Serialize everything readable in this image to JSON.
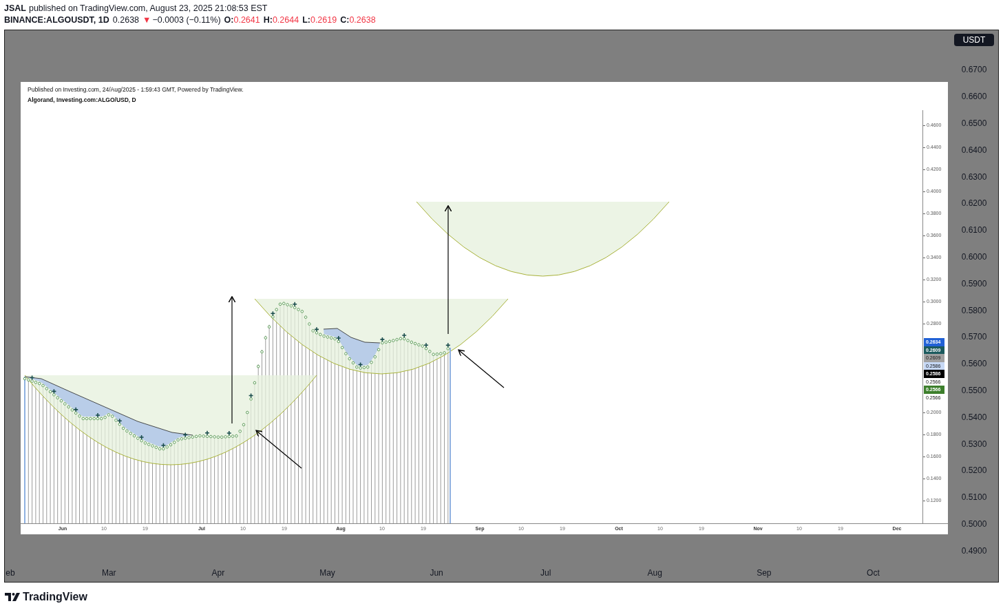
{
  "header": {
    "author": "JSAL",
    "published": "published on TradingView.com, August 23, 2025 21:08:53 EST"
  },
  "symbol_bar": {
    "symbol": "BINANCE:ALGOUSDT, 1D",
    "last": "0.2638",
    "change_icon": "▼",
    "change": "−0.0003 (−0.11%)",
    "ohlc": [
      {
        "label": "O:",
        "value": "0.2641"
      },
      {
        "label": "H:",
        "value": "0.2644"
      },
      {
        "label": "L:",
        "value": "0.2619"
      },
      {
        "label": "C:",
        "value": "0.2638"
      }
    ]
  },
  "chart": {
    "currency": "USDT",
    "price_axis": [
      "0.6700",
      "0.6600",
      "0.6500",
      "0.6400",
      "0.6300",
      "0.6200",
      "0.6100",
      "0.6000",
      "0.5900",
      "0.5800",
      "0.5700",
      "0.5600",
      "0.5500",
      "0.5400",
      "0.5300",
      "0.5200",
      "0.5100",
      "0.5000",
      "0.4900"
    ],
    "time_axis": [
      "eb",
      "Mar",
      "Apr",
      "May",
      "Jun",
      "Jul",
      "Aug",
      "Sep",
      "Oct"
    ],
    "image": {
      "caption": "Published on Investing.com, 24/Aug/2025 - 1:59:43 GMT, Powered by TradingView.",
      "title": "Algorand, Investing.com:ALGO/USD, D",
      "price_axis_upper": [
        "0.4600",
        "0.4400",
        "0.4200",
        "0.4000",
        "0.3800",
        "0.3600",
        "0.3400",
        "0.3200",
        "0.3000",
        "0.2800"
      ],
      "price_badges": [
        {
          "value": "0.2634",
          "color": "#2161d6"
        },
        {
          "value": "0.2609",
          "color": "#1b5a5e"
        },
        {
          "value": "0.2609",
          "color": "#a0a0a0"
        },
        {
          "value": "0.2586",
          "color": "#c6d8f5"
        },
        {
          "value": "0.2586",
          "color": "#000000"
        },
        {
          "value": "0.2566",
          "color": "#ffffff"
        },
        {
          "value": "0.2566",
          "color": "#3d7f2c"
        },
        {
          "value": "0.2566",
          "color": "#ffffff"
        }
      ],
      "price_axis_lower": [
        "0.2000",
        "0.1800",
        "0.1600",
        "0.1400",
        "0.1200"
      ],
      "time_axis": [
        {
          "label": "Jun",
          "kind": "month"
        },
        {
          "label": "10",
          "kind": "day"
        },
        {
          "label": "19",
          "kind": "day"
        },
        {
          "label": "Jul",
          "kind": "month"
        },
        {
          "label": "10",
          "kind": "day"
        },
        {
          "label": "19",
          "kind": "day"
        },
        {
          "label": "Aug",
          "kind": "month"
        },
        {
          "label": "10",
          "kind": "day"
        },
        {
          "label": "19",
          "kind": "day"
        },
        {
          "label": "Sep",
          "kind": "month"
        },
        {
          "label": "10",
          "kind": "day"
        },
        {
          "label": "19",
          "kind": "day"
        },
        {
          "label": "Oct",
          "kind": "month"
        },
        {
          "label": "10",
          "kind": "day"
        },
        {
          "label": "19",
          "kind": "day"
        },
        {
          "label": "Nov",
          "kind": "month"
        },
        {
          "label": "10",
          "kind": "day"
        },
        {
          "label": "19",
          "kind": "day"
        },
        {
          "label": "Dec",
          "kind": "month"
        }
      ]
    }
  },
  "footer": {
    "logo": "TradingView"
  }
}
